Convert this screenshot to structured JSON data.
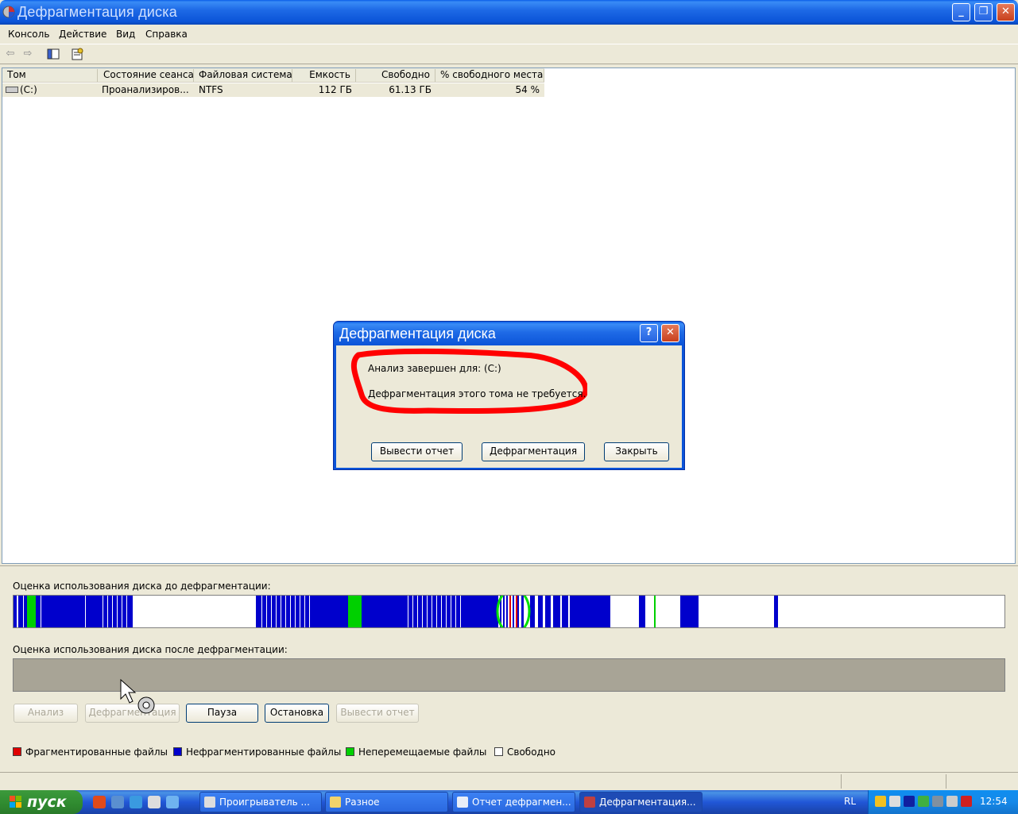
{
  "window": {
    "title": "Дефрагментация диска",
    "minimize": "_",
    "restore": "❐",
    "close": "✕"
  },
  "menu": {
    "items": [
      "Консоль",
      "Действие",
      "Вид",
      "Справка"
    ]
  },
  "toolbar": {
    "back_icon": "back-arrow-icon",
    "forward_icon": "forward-arrow-icon"
  },
  "volumes": {
    "columns": [
      "Том",
      "Состояние сеанса",
      "Файловая система",
      "Емкость",
      "Свободно",
      "% свободного места"
    ],
    "rows": [
      {
        "volume": "(C:)",
        "status": "Проанализиров...",
        "fs": "NTFS",
        "capacity": "112 ГБ",
        "free": "61.13 ГБ",
        "free_percent": "54 %"
      }
    ]
  },
  "panel": {
    "before_label": "Оценка использования диска до дефрагментации:",
    "after_label": "Оценка использования диска после дефрагментации:",
    "buttons": {
      "analyze": "Анализ",
      "defrag": "Дефрагментация",
      "pause": "Пауза",
      "stop": "Остановка",
      "report": "Вывести отчет"
    },
    "legend": {
      "fragmented": "Фрагментированные файлы",
      "contiguous": "Нефрагментированные файлы",
      "unmovable": "Неперемещаемые файлы",
      "free": "Свободно"
    },
    "colors": {
      "fragmented": "#e00000",
      "contiguous": "#0000cc",
      "unmovable": "#00d000",
      "free": "#ffffff"
    }
  },
  "dialog": {
    "title": "Дефрагментация диска",
    "help": "?",
    "close": "✕",
    "line1": "Анализ завершен для: (C:)",
    "line2": "Дефрагментация этого тома не требуется.",
    "buttons": {
      "report": "Вывести отчет",
      "defrag": "Дефрагментация",
      "close": "Закрыть"
    }
  },
  "taskbar": {
    "start": "пуск",
    "tasks": [
      {
        "label": "Проигрыватель ...",
        "active": false
      },
      {
        "label": "Разное",
        "active": false
      },
      {
        "label": "Отчет дефрагмен...",
        "active": false
      },
      {
        "label": "Дефрагментация...",
        "active": true
      }
    ],
    "lang": "RL",
    "clock": "12:54"
  }
}
